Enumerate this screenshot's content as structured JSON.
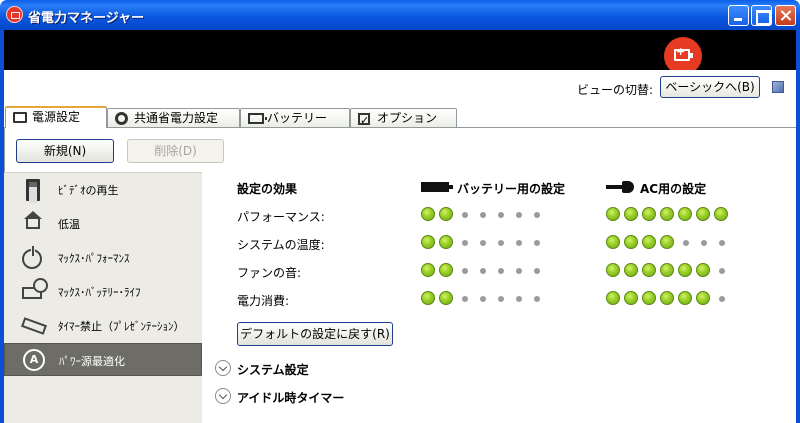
{
  "window": {
    "title": "省電力マネージャー"
  },
  "viewbar": {
    "label": "ビューの切替:",
    "button": "ベーシックへ(B)"
  },
  "tabs": [
    {
      "label": "電源設定",
      "icon": "screen-icon",
      "active": true
    },
    {
      "label": "共通省電力設定",
      "icon": "gear-icon",
      "active": false
    },
    {
      "label": "バッテリー",
      "icon": "battery-icon",
      "active": false
    },
    {
      "label": "オプション",
      "icon": "checkbox-icon",
      "active": false
    }
  ],
  "actions": {
    "new_label": "新規(N)",
    "delete_label": "削除(D)"
  },
  "schemes": [
    {
      "label": "ﾋﾞﾃﾞｵの再生",
      "icon": "film-icon"
    },
    {
      "label": "低温",
      "icon": "house-icon"
    },
    {
      "label": "ﾏｯｸｽ･ﾊﾟﾌｫｰﾏﾝｽ",
      "icon": "power-icon"
    },
    {
      "label": "ﾏｯｸｽ･ﾊﾞｯﾃﾘｰ･ﾗｲﾌ",
      "icon": "battery-clock-icon"
    },
    {
      "label": "ﾀｲﾏｰ禁止（ﾌﾟﾚｾﾞﾝﾃｰｼｮﾝ）",
      "icon": "projector-icon"
    },
    {
      "label": "ﾊﾟﾜｰ源最適化",
      "icon": "auto-icon",
      "selected": true
    }
  ],
  "effects": {
    "heading": "設定の効果",
    "battery_heading": "バッテリー用の設定",
    "ac_heading": "AC用の設定",
    "rows": [
      {
        "label": "パフォーマンス:",
        "battery_level": 2,
        "ac_level": 7
      },
      {
        "label": "システムの温度:",
        "battery_level": 2,
        "ac_level": 4
      },
      {
        "label": "ファンの音:",
        "battery_level": 2,
        "ac_level": 6
      },
      {
        "label": "電力消費:",
        "battery_level": 2,
        "ac_level": 6
      }
    ],
    "max_level": 7,
    "reset_label": "デフォルトの設定に戻す(R)"
  },
  "sections": {
    "system": "システム設定",
    "idle": "アイドル時タイマー"
  },
  "colors": {
    "titlebar": "#0a58e0",
    "banner": "#000000",
    "accent_red": "#e63a22",
    "dot_green": "#9cd12a",
    "selected_bg": "#6d6d66"
  }
}
